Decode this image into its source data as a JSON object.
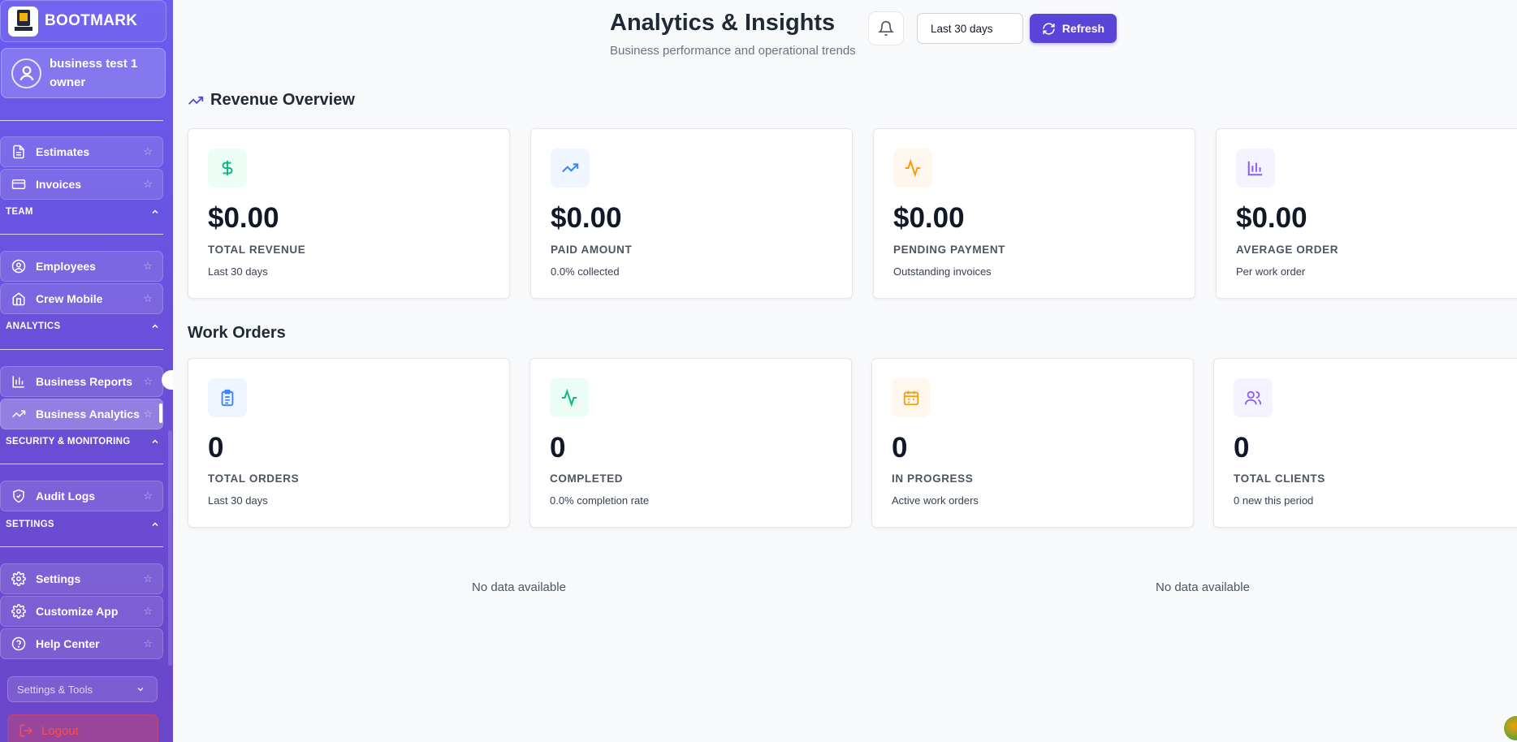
{
  "sidebar": {
    "brand": "BOOTMARK",
    "user": {
      "name": "business test 1",
      "role": "owner"
    },
    "items_top": [
      {
        "label": "Estimates",
        "icon": "file-text-icon"
      },
      {
        "label": "Invoices",
        "icon": "credit-card-icon"
      }
    ],
    "sections": {
      "team": "TEAM",
      "analytics": "ANALYTICS",
      "security": "SECURITY & MONITORING",
      "settings": "SETTINGS"
    },
    "team_items": [
      {
        "label": "Employees",
        "icon": "user-circle-icon"
      },
      {
        "label": "Crew Mobile",
        "icon": "home-icon"
      }
    ],
    "analytics_items": [
      {
        "label": "Business Reports",
        "icon": "bar-chart-icon"
      },
      {
        "label": "Business Analytics",
        "icon": "trending-up-icon"
      }
    ],
    "security_items": [
      {
        "label": "Audit Logs",
        "icon": "shield-check-icon"
      }
    ],
    "settings_items": [
      {
        "label": "Settings",
        "icon": "gear-icon"
      },
      {
        "label": "Customize App",
        "icon": "gear-icon"
      },
      {
        "label": "Help Center",
        "icon": "help-circle-icon"
      }
    ],
    "tools_select": "Settings & Tools",
    "logout": "Logout"
  },
  "header": {
    "title": "Analytics & Insights",
    "subtitle": "Business performance and operational trends",
    "range": "Last 30 days",
    "refresh": "Refresh"
  },
  "revenue": {
    "title": "Revenue Overview",
    "cards": [
      {
        "value": "$0.00",
        "label": "TOTAL REVENUE",
        "sub": "Last 30 days",
        "icon": "dollar-icon",
        "color": "#10b981",
        "bg": "#ecfdf5"
      },
      {
        "value": "$0.00",
        "label": "PAID AMOUNT",
        "sub": "0.0% collected",
        "icon": "trending-up-icon",
        "color": "#3b82f6",
        "bg": "#eff6ff"
      },
      {
        "value": "$0.00",
        "label": "PENDING PAYMENT",
        "sub": "Outstanding invoices",
        "icon": "activity-icon",
        "color": "#f59e0b",
        "bg": "#fff7ed"
      },
      {
        "value": "$0.00",
        "label": "AVERAGE ORDER",
        "sub": "Per work order",
        "icon": "bar-chart-icon",
        "color": "#8b5cf6",
        "bg": "#f5f3ff"
      }
    ]
  },
  "work_orders": {
    "title": "Work Orders",
    "cards": [
      {
        "value": "0",
        "label": "TOTAL ORDERS",
        "sub": "Last 30 days",
        "icon": "clipboard-icon",
        "color": "#3b82f6",
        "bg": "#eff6ff"
      },
      {
        "value": "0",
        "label": "COMPLETED",
        "sub": "0.0% completion rate",
        "icon": "activity-icon",
        "color": "#10b981",
        "bg": "#ecfdf5"
      },
      {
        "value": "0",
        "label": "IN PROGRESS",
        "sub": "Active work orders",
        "icon": "calendar-icon",
        "color": "#f59e0b",
        "bg": "#fff7ed"
      },
      {
        "value": "0",
        "label": "TOTAL CLIENTS",
        "sub": "0 new this period",
        "icon": "users-icon",
        "color": "#8b5cf6",
        "bg": "#f5f3ff"
      }
    ]
  },
  "empty": {
    "left": "No data available",
    "right": "No data available"
  }
}
